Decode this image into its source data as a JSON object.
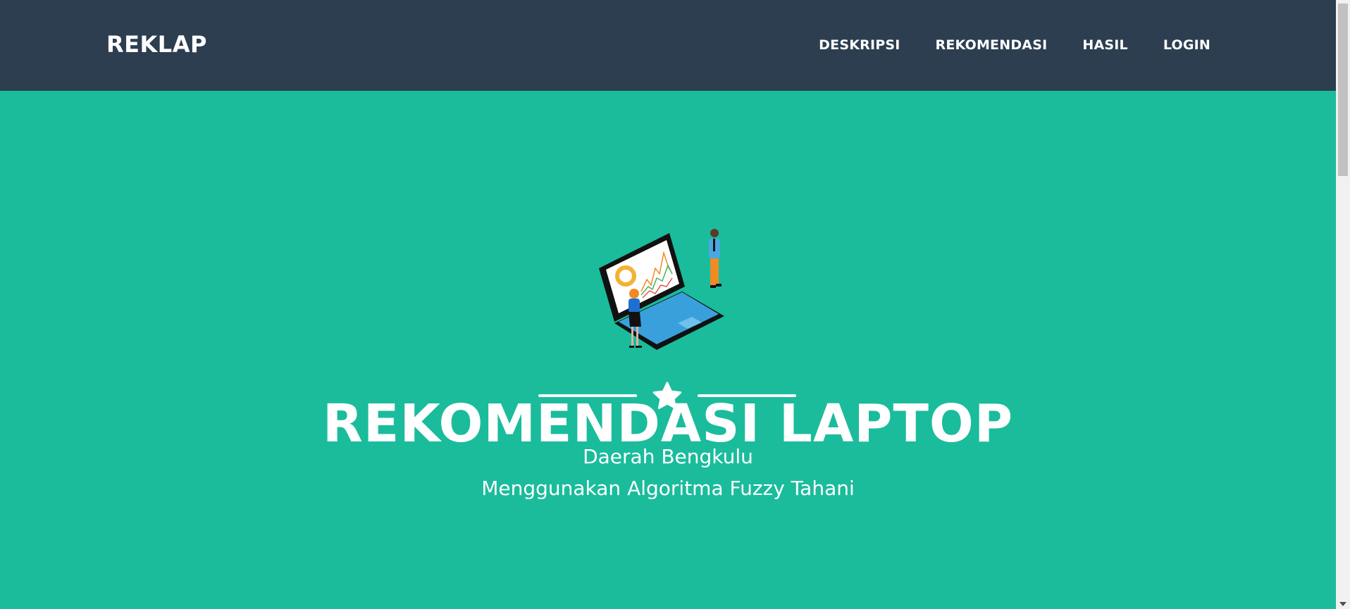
{
  "navbar": {
    "brand": "REKLAP",
    "links": [
      "DESKRIPSI",
      "REKOMENDASI",
      "HASIL",
      "LOGIN"
    ]
  },
  "hero": {
    "title": "REKOMENDASI LAPTOP",
    "subtitle_line1": "Daerah Bengkulu",
    "subtitle_line2": "Menggunakan Algoritma Fuzzy Tahani",
    "divider_icon": "star-icon",
    "illustration": "laptop-analytics-illustration"
  },
  "colors": {
    "navbar_bg": "#2c3e50",
    "hero_bg": "#1abc9c",
    "text": "#ffffff"
  }
}
